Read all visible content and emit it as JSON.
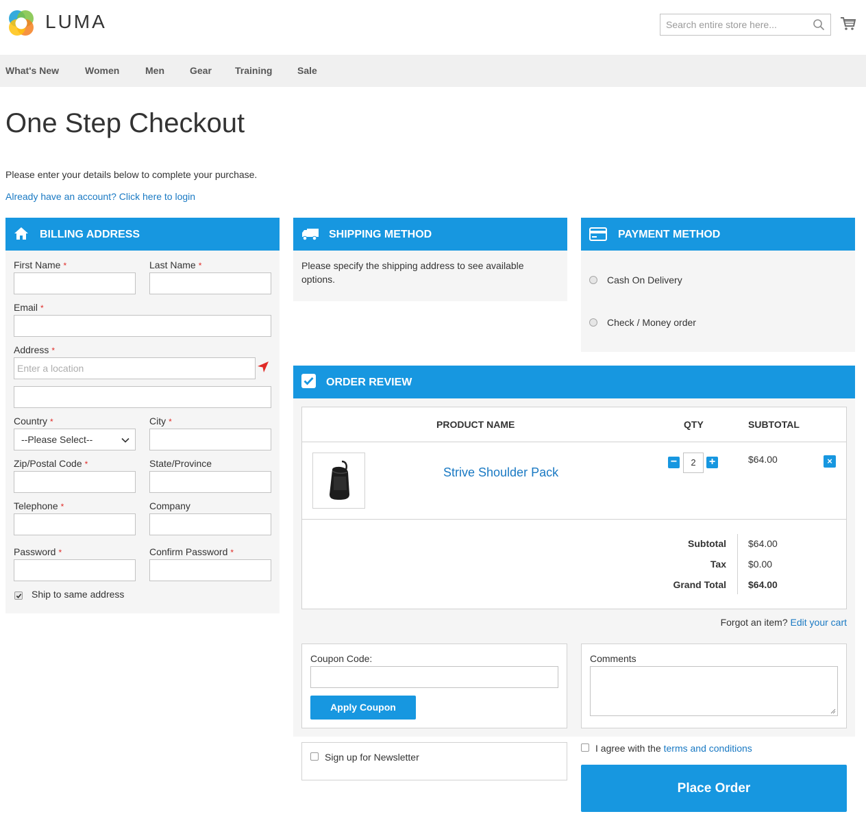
{
  "header": {
    "logo_text": "LUMA",
    "search_placeholder": "Search entire store here...",
    "nav": [
      "What's New",
      "Women",
      "Men",
      "Gear",
      "Training",
      "Sale"
    ]
  },
  "page": {
    "title": "One Step Checkout",
    "intro": "Please enter your details below to complete your purchase.",
    "login_link": "Already have an account? Click here to login"
  },
  "billing": {
    "heading": "BILLING ADDRESS",
    "first_name": "First Name",
    "last_name": "Last Name",
    "email": "Email",
    "address": "Address",
    "address_placeholder": "Enter a location",
    "country": "Country",
    "country_value": "--Please Select--",
    "city": "City",
    "zip": "Zip/Postal Code",
    "state": "State/Province",
    "telephone": "Telephone",
    "company": "Company",
    "password": "Password",
    "confirm_password": "Confirm Password",
    "ship_same": "Ship to same address",
    "required_mark": "*"
  },
  "shipping": {
    "heading": "SHIPPING METHOD",
    "message": "Please specify the shipping address to see available options."
  },
  "payment": {
    "heading": "PAYMENT METHOD",
    "options": [
      "Cash On Delivery",
      "Check / Money order"
    ]
  },
  "review": {
    "heading": "ORDER REVIEW",
    "columns": {
      "product": "PRODUCT NAME",
      "qty": "QTY",
      "subtotal": "SUBTOTAL"
    },
    "item": {
      "name": "Strive Shoulder Pack",
      "qty": "2",
      "subtotal": "$64.00",
      "minus": "−",
      "plus": "+",
      "remove": "×"
    },
    "totals": {
      "subtotal_label": "Subtotal",
      "subtotal_value": "$64.00",
      "tax_label": "Tax",
      "tax_value": "$0.00",
      "grand_label": "Grand Total",
      "grand_value": "$64.00"
    },
    "forgot_text": "Forgot an item?",
    "edit_cart": "Edit your cart"
  },
  "coupon": {
    "label": "Coupon Code:",
    "button": "Apply Coupon"
  },
  "comments": {
    "label": "Comments"
  },
  "newsletter": {
    "label": "Sign up for Newsletter"
  },
  "terms": {
    "prefix": "I agree with the",
    "link": "terms and conditions"
  },
  "place_order": "Place Order",
  "colors": {
    "accent": "#1797e0",
    "link": "#1979c3",
    "required": "#e02b27",
    "panel": "#f5f5f5"
  }
}
